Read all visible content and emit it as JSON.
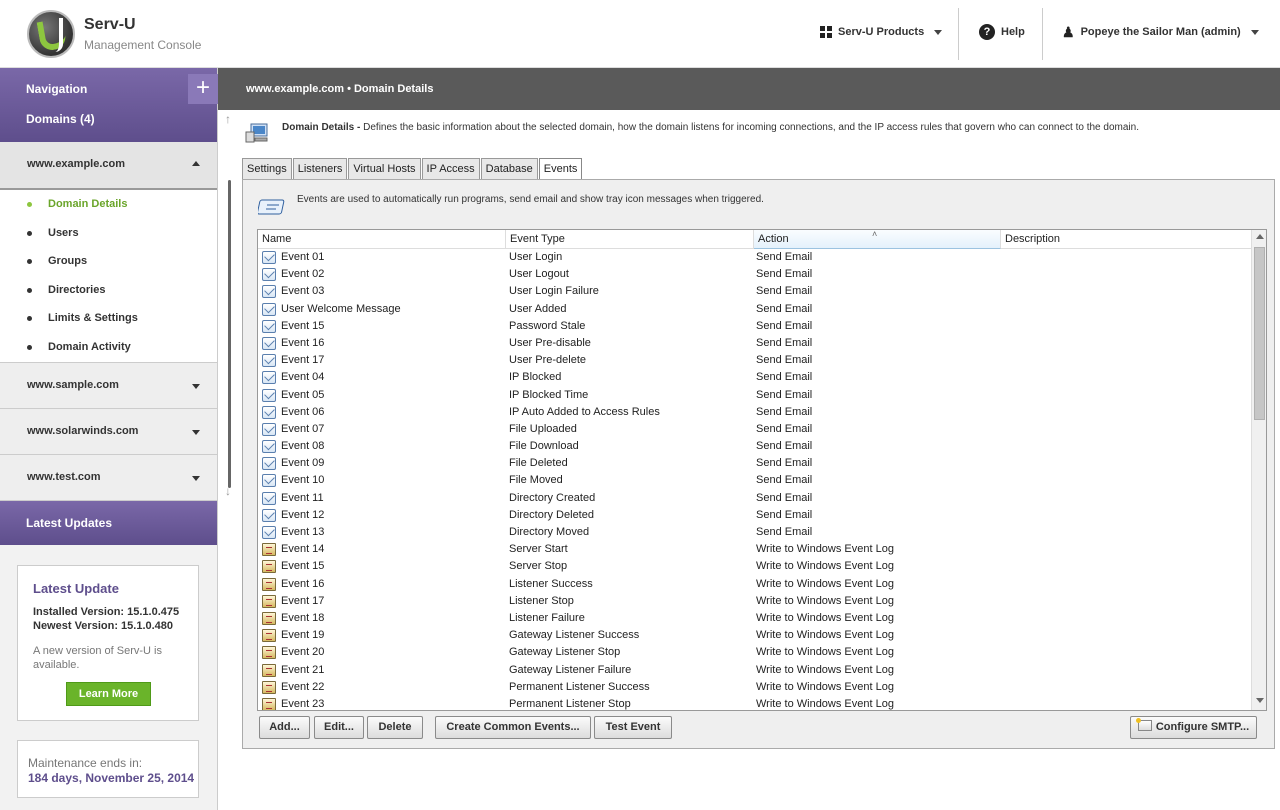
{
  "app": {
    "title": "Serv-U",
    "subtitle": "Management Console"
  },
  "header": {
    "products_label": "Serv-U Products",
    "help_label": "Help",
    "user_label": "Popeye the Sailor Man (admin)"
  },
  "sidebar": {
    "nav_title": "Navigation",
    "add_symbol": "+",
    "domains_label": "Domains (4)",
    "active_domain": "www.example.com",
    "subnav": [
      "Domain Details",
      "Users",
      "Groups",
      "Directories",
      "Limits & Settings",
      "Domain Activity"
    ],
    "other_domains": [
      "www.sample.com",
      "www.solarwinds.com",
      "www.test.com"
    ],
    "latest_updates_label": "Latest Updates",
    "update_box": {
      "title": "Latest Update",
      "installed": "Installed Version: 15.1.0.475",
      "newest": "Newest Version: 15.1.0.480",
      "note": "A new version of Serv-U is available.",
      "button": "Learn More"
    },
    "maintenance": {
      "line1": "Maintenance ends in:",
      "line2": "184 days, November 25, 2014"
    }
  },
  "breadcrumb": "www.example.com • Domain Details",
  "description": {
    "title": "Domain Details -",
    "text": "Defines the basic information about the selected domain, how the domain listens for incoming connections, and the IP access rules that govern who can connect to the domain."
  },
  "tabs": [
    "Settings",
    "Listeners",
    "Virtual Hosts",
    "IP Access",
    "Database",
    "Events"
  ],
  "active_tab": "Events",
  "events_intro": "Events are used to automatically run programs, send email and show tray icon messages when triggered.",
  "columns": [
    "Name",
    "Event Type",
    "Action",
    "Description"
  ],
  "sorted_column": "Action",
  "rows": [
    {
      "icon": "envelope-icon",
      "name": "Event 01",
      "type": "User Login",
      "action": "Send Email"
    },
    {
      "icon": "envelope-icon",
      "name": "Event 02",
      "type": "User Logout",
      "action": "Send Email"
    },
    {
      "icon": "envelope-icon",
      "name": "Event 03",
      "type": "User Login Failure",
      "action": "Send Email"
    },
    {
      "icon": "envelope-icon",
      "name": "User Welcome Message",
      "type": "User Added",
      "action": "Send Email"
    },
    {
      "icon": "envelope-icon",
      "name": "Event 15",
      "type": "Password Stale",
      "action": "Send Email"
    },
    {
      "icon": "envelope-icon",
      "name": "Event 16",
      "type": "User Pre-disable",
      "action": "Send Email"
    },
    {
      "icon": "envelope-icon",
      "name": "Event 17",
      "type": "User Pre-delete",
      "action": "Send Email"
    },
    {
      "icon": "envelope-icon",
      "name": "Event 04",
      "type": "IP Blocked",
      "action": "Send Email"
    },
    {
      "icon": "envelope-icon",
      "name": "Event 05",
      "type": "IP Blocked Time",
      "action": "Send Email"
    },
    {
      "icon": "envelope-icon",
      "name": "Event 06",
      "type": "IP Auto Added to Access Rules",
      "action": "Send Email"
    },
    {
      "icon": "envelope-icon",
      "name": "Event 07",
      "type": "File Uploaded",
      "action": "Send Email"
    },
    {
      "icon": "envelope-icon",
      "name": "Event 08",
      "type": "File Download",
      "action": "Send Email"
    },
    {
      "icon": "envelope-icon",
      "name": "Event 09",
      "type": "File Deleted",
      "action": "Send Email"
    },
    {
      "icon": "envelope-icon",
      "name": "Event 10",
      "type": "File Moved",
      "action": "Send Email"
    },
    {
      "icon": "envelope-icon",
      "name": "Event 11",
      "type": "Directory Created",
      "action": "Send Email"
    },
    {
      "icon": "envelope-icon",
      "name": "Event 12",
      "type": "Directory Deleted",
      "action": "Send Email"
    },
    {
      "icon": "envelope-icon",
      "name": "Event 13",
      "type": "Directory Moved",
      "action": "Send Email"
    },
    {
      "icon": "event-log-icon",
      "name": "Event 14",
      "type": "Server Start",
      "action": "Write to Windows Event Log"
    },
    {
      "icon": "event-log-icon",
      "name": "Event 15",
      "type": "Server Stop",
      "action": "Write to Windows Event Log"
    },
    {
      "icon": "event-log-icon",
      "name": "Event 16",
      "type": "Listener Success",
      "action": "Write to Windows Event Log"
    },
    {
      "icon": "event-log-icon",
      "name": "Event 17",
      "type": "Listener Stop",
      "action": "Write to Windows Event Log"
    },
    {
      "icon": "event-log-icon",
      "name": "Event 18",
      "type": "Listener Failure",
      "action": "Write to Windows Event Log"
    },
    {
      "icon": "event-log-icon",
      "name": "Event 19",
      "type": "Gateway Listener Success",
      "action": "Write to Windows Event Log"
    },
    {
      "icon": "event-log-icon",
      "name": "Event 20",
      "type": "Gateway Listener Stop",
      "action": "Write to Windows Event Log"
    },
    {
      "icon": "event-log-icon",
      "name": "Event 21",
      "type": "Gateway Listener Failure",
      "action": "Write to Windows Event Log"
    },
    {
      "icon": "event-log-icon",
      "name": "Event 22",
      "type": "Permanent Listener Success",
      "action": "Write to Windows Event Log"
    },
    {
      "icon": "event-log-icon",
      "name": "Event 23",
      "type": "Permanent Listener Stop",
      "action": "Write to Windows Event Log"
    }
  ],
  "buttons": {
    "add": "Add...",
    "edit": "Edit...",
    "delete": "Delete",
    "create_common": "Create Common Events...",
    "test": "Test Event",
    "smtp": "Configure SMTP..."
  },
  "colors": {
    "accent_purple": "#6b5b95",
    "active_green": "#6aa52a",
    "button_green": "#6ab42a",
    "crumb_bar": "#5a5a5a"
  }
}
